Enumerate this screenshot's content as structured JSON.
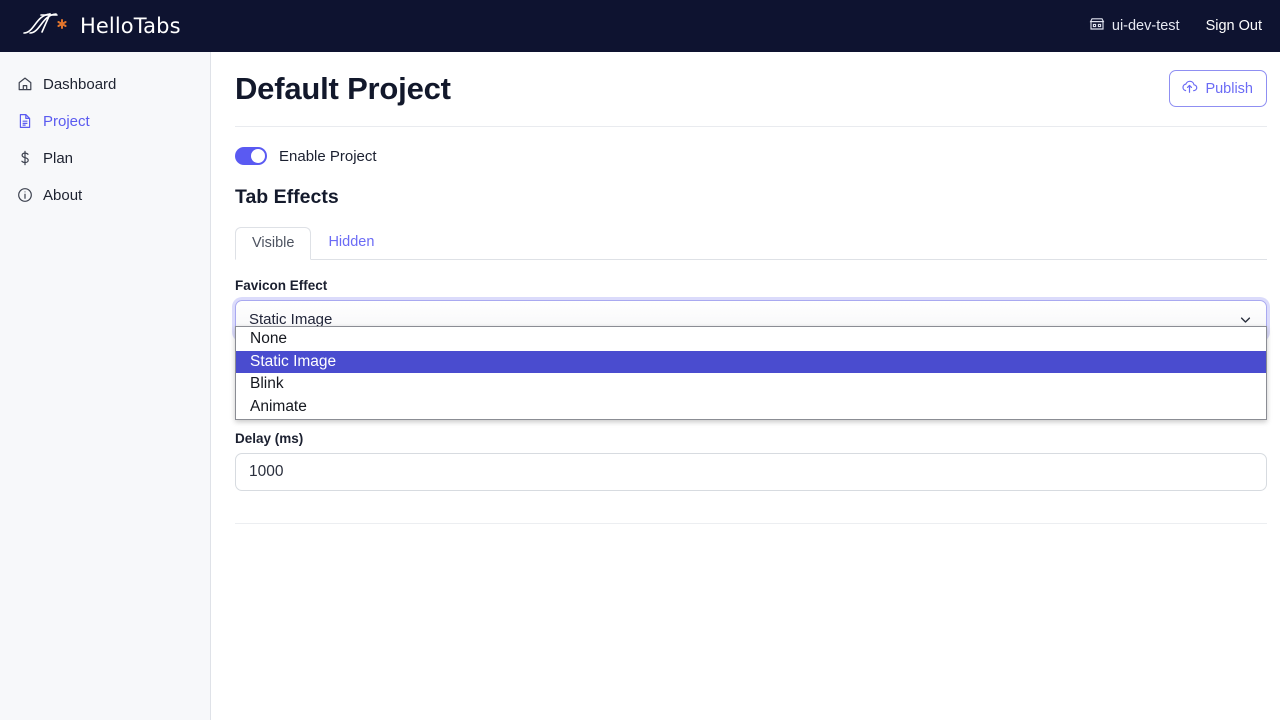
{
  "navbar": {
    "brand": "HelloTabs",
    "brand_icon": "swoosh-star-logo",
    "user_icon": "store-icon",
    "user": "ui-dev-test",
    "sign_out": "Sign Out",
    "background": "#0e1330"
  },
  "sidebar": {
    "items": [
      {
        "label": "Dashboard",
        "icon": "home-icon",
        "active": false
      },
      {
        "label": "Project",
        "icon": "file-document-icon",
        "active": true
      },
      {
        "label": "Plan",
        "icon": "dollar-icon",
        "active": false
      },
      {
        "label": "About",
        "icon": "info-circle-icon",
        "active": false
      }
    ],
    "background": "#f7f8fa",
    "active_color": "#5b5bf0"
  },
  "page": {
    "title": "Default Project",
    "publish_label": "Publish",
    "publish_icon": "cloud-upload-icon",
    "accent": "#6b6bf5"
  },
  "enable_toggle": {
    "label": "Enable Project",
    "state": "on",
    "on_color": "#5a5af2"
  },
  "tab_effects": {
    "section_title": "Tab Effects",
    "tabs": [
      {
        "label": "Visible",
        "active": true
      },
      {
        "label": "Hidden",
        "active": false
      }
    ]
  },
  "favicon_effect": {
    "label": "Favicon Effect",
    "selected": "Static Image",
    "chevron_icon": "chevron-down-icon",
    "open": true,
    "highlight_color": "#4a4ccf",
    "options": [
      {
        "label": "None",
        "selected": false
      },
      {
        "label": "Static Image",
        "selected": true
      },
      {
        "label": "Blink",
        "selected": false
      },
      {
        "label": "Animate",
        "selected": false
      }
    ]
  },
  "delay": {
    "label": "Delay (ms)",
    "value": "1000"
  }
}
